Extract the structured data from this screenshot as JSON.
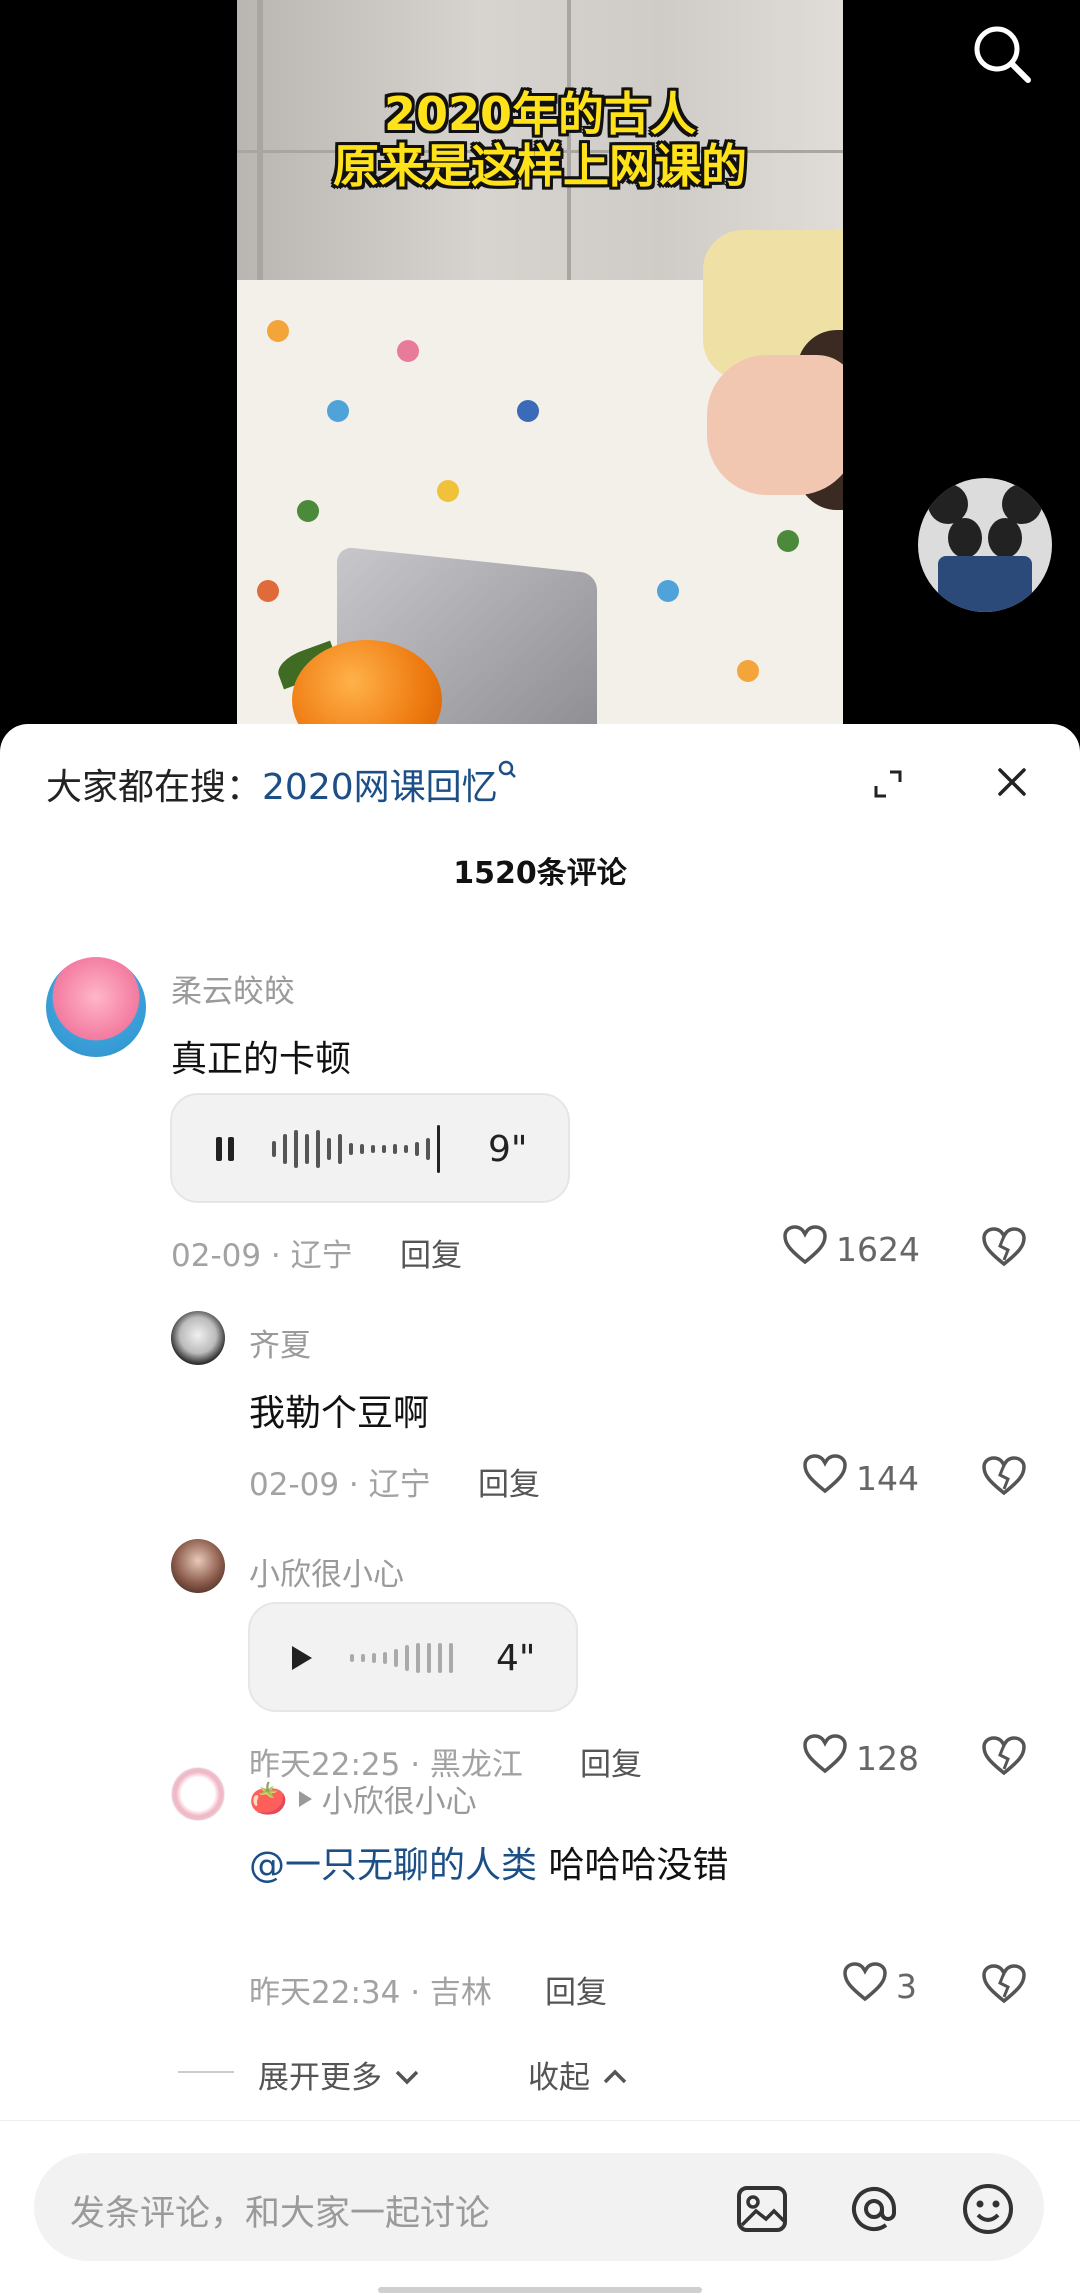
{
  "video": {
    "caption_line1": "2020年的古人",
    "caption_line2": "原来是这样上网课的"
  },
  "comments_panel": {
    "hot_search_label": "大家都在搜：",
    "hot_search_keyword": "2020网课回忆",
    "comment_count": "1520条评论",
    "expand_more": "展开更多",
    "collapse": "收起"
  },
  "comments": [
    {
      "user": "柔云皎皎",
      "text": "真正的卡顿",
      "voice_duration": "9\"",
      "voice_state": "playing",
      "date_location": "02-09 · 辽宁",
      "reply_label": "回复",
      "likes": "1624"
    },
    {
      "user": "齐夏",
      "text": "我勒个豆啊",
      "date_location": "02-09 · 辽宁",
      "reply_label": "回复",
      "likes": "144"
    },
    {
      "user": "小欣很小心",
      "voice_duration": "4\"",
      "voice_state": "paused",
      "date_location": "昨天22:25 · 黑龙江",
      "reply_label": "回复",
      "likes": "128"
    },
    {
      "user_prefix": "🍅",
      "reply_to": "小欣很小心",
      "mention": "@一只无聊的人类",
      "text": " 哈哈哈没错",
      "date_location": "昨天22:34 · 吉林",
      "reply_label": "回复",
      "likes": "3"
    }
  ],
  "footer": {
    "input_placeholder": "发条评论，和大家一起讨论"
  },
  "colors": {
    "link_blue": "#1b4f86",
    "caption_yellow": "#ffe21a"
  },
  "icons": [
    "search-icon",
    "expand-icon",
    "close-icon",
    "pause-icon",
    "play-icon",
    "heart-icon",
    "broken-heart-icon",
    "image-icon",
    "at-icon",
    "emoji-icon",
    "chevron-down-icon",
    "chevron-up-icon",
    "small-search-icon",
    "small-play-icon"
  ]
}
